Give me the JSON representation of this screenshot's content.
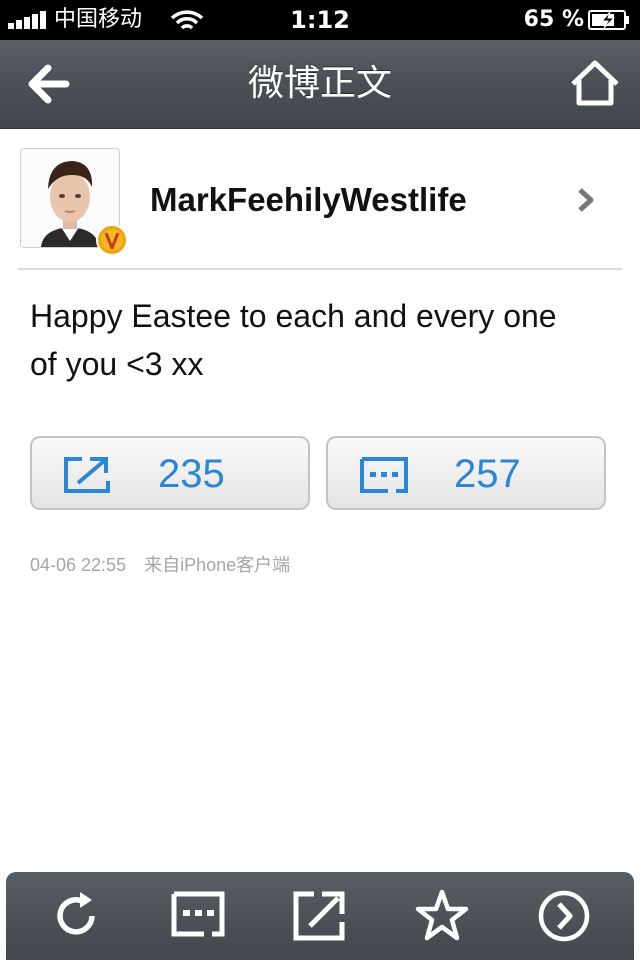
{
  "status_bar": {
    "carrier": "中国移动",
    "time": "1:12",
    "battery": "65 %"
  },
  "nav": {
    "title": "微博正文",
    "back_icon": "back-arrow-icon",
    "home_icon": "home-icon"
  },
  "post": {
    "username": "MarkFeehilyWestlife",
    "verified_badge": "V",
    "text": "Happy Eastee to each and every one of you <3 xx",
    "repost_count": "235",
    "comment_count": "257",
    "time": "04-06 22:55",
    "source": "来自iPhone客户端"
  },
  "toolbar": {
    "items": [
      "refresh-icon",
      "comment-icon",
      "repost-icon",
      "star-icon",
      "forward-circle-icon"
    ]
  },
  "colors": {
    "accent": "#2a86d6",
    "nav_bg": "#4a4f56",
    "badge": "#f2a20a"
  }
}
